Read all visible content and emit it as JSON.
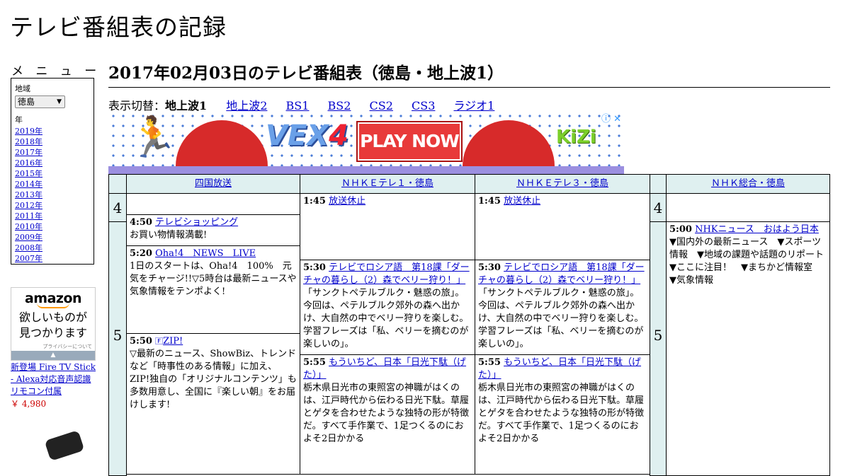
{
  "site": {
    "title": "テレビ番組表の記録"
  },
  "menu": {
    "label": "メ ニ ュ ー",
    "region_label": "地域",
    "region_value": "徳島",
    "year_label": "年",
    "years": [
      "2019年",
      "2018年",
      "2017年",
      "2016年",
      "2015年",
      "2014年",
      "2013年",
      "2012年",
      "2011年",
      "2010年",
      "2009年",
      "2008年",
      "2007年"
    ]
  },
  "ad_side": {
    "logo": "amazon",
    "tagline_1": "欲しいものが",
    "tagline_2": "見つかります",
    "privacy": "プライバシーについて",
    "product": "新登場 Fire TV Stick - Alexa対応音声認識リモコン付属",
    "price": "￥ 4,980"
  },
  "page": {
    "heading": "2017年02月03日のテレビ番組表（徳島・地上波1）",
    "switch_label": "表示切替：",
    "switch_current": "地上波1",
    "switch_links": [
      "地上波2",
      "BS1",
      "BS2",
      "CS2",
      "CS3",
      "ラジオ1"
    ]
  },
  "banner": {
    "logo_left": "VEX",
    "logo_right": "4",
    "play": "PLAY NOW",
    "brand": "KiZi",
    "info": "ⓘ ✕"
  },
  "grid": {
    "channels": [
      "四国放送",
      "ＮＨＫＥテレ１・徳島",
      "ＮＨＫＥテレ３・徳島",
      "ＮＨＫ総合・徳島"
    ],
    "hours": [
      "4",
      "5"
    ],
    "ch1": [
      {
        "time": "4:50",
        "title": "テレビショッピング",
        "desc": "お買い物情報満載!"
      },
      {
        "time": "5:20",
        "title": "Oha!4　NEWS　LIVE",
        "desc": "1日のスタートは、Oha!4　100%　元気をチャージ!!▽5時台は最新ニュースや気象情報をテンポよく!"
      },
      {
        "time": "5:50",
        "title": "ZIP!",
        "desc": "▽最新のニュース、ShowBiz、トレンドなど「時事性のある情報」に加え、ZIP!独自の「オリジナルコンテンツ」も多数用意し、全国に『楽しい朝』をお届けします!"
      }
    ],
    "ch2": [
      {
        "time": "1:45",
        "title": "放送休止",
        "desc": ""
      },
      {
        "time": "5:30",
        "title": "テレビでロシア語　第18課「ダーチャの暮らし（2）森でベリー狩り！」",
        "desc": "「サンクトペテルブルク・魅惑の旅」。今回は、ペテルブルク郊外の森へ出かけ、大自然の中でベリー狩りを楽しむ。学習フレーズは「私、ベリーを摘むのが楽しいの」。"
      },
      {
        "time": "5:55",
        "title": "もういちど、日本「日光下駄（げた）」",
        "desc": "栃木県日光市の東照宮の神職がはくのは、江戸時代から伝わる日光下駄。草履とゲタを合わせたような独特の形が特徴だ。すべて手作業で、1足つくるのにおよそ2日かかる"
      }
    ],
    "ch3": [
      {
        "time": "1:45",
        "title": "放送休止",
        "desc": ""
      },
      {
        "time": "5:30",
        "title": "テレビでロシア語　第18課「ダーチャの暮らし（2）森でベリー狩り！」",
        "desc": "「サンクトペテルブルク・魅惑の旅」。今回は、ペテルブルク郊外の森へ出かけ、大自然の中でベリー狩りを楽しむ。学習フレーズは「私、ベリーを摘むのが楽しいの」。"
      },
      {
        "time": "5:55",
        "title": "もういちど、日本「日光下駄（げた）」",
        "desc": "栃木県日光市の東照宮の神職がはくのは、江戸時代から伝わる日光下駄。草履とゲタを合わせたような独特の形が特徴だ。すべて手作業で、1足つくるのにおよそ2日かかる"
      }
    ],
    "ch4": [
      {
        "time": "5:00",
        "title": "NHKニュース　おはよう日本",
        "desc": "▼国内外の最新ニュース　▼スポーツ情報　▼地域の課題や話題のリポート　▼ここに注目！　▼まちかど情報室　▼気象情報"
      }
    ]
  }
}
